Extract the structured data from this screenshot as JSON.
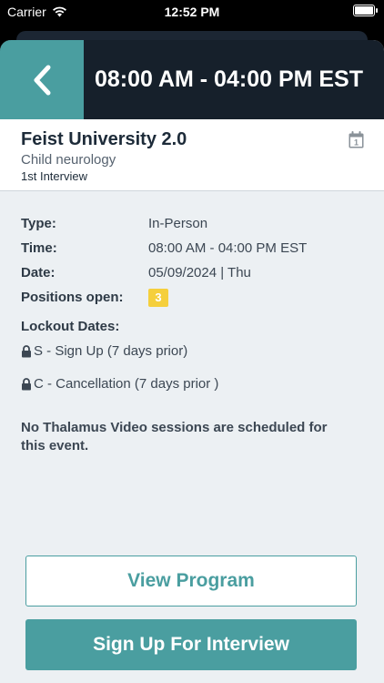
{
  "status_bar": {
    "carrier": "Carrier",
    "time": "12:52 PM",
    "icons": [
      "wifi-icon",
      "battery-icon"
    ]
  },
  "header": {
    "title": "08:00 AM - 04:00 PM EST",
    "back_icon": "chevron-left-icon",
    "accent_color": "#4a9ea0",
    "bar_color": "#16202b"
  },
  "event": {
    "title": "Feist University 2.0",
    "specialty": "Child neurology",
    "round": "1st Interview",
    "calendar_icon_day": "1"
  },
  "details": {
    "type_label": "Type:",
    "type_value": "In-Person",
    "time_label": "Time:",
    "time_value": "08:00 AM - 04:00 PM EST",
    "date_label": "Date:",
    "date_value": "05/09/2024 | Thu",
    "positions_label": "Positions open:",
    "positions_value": "3",
    "positions_badge_color": "#f5cf3c"
  },
  "lockout": {
    "title": "Lockout Dates:",
    "items": [
      "S - Sign Up (7 days prior)",
      "C - Cancellation (7 days prior )"
    ]
  },
  "note": "No Thalamus Video sessions are scheduled for this event.",
  "buttons": {
    "view_program": "View Program",
    "sign_up": "Sign Up For Interview"
  }
}
